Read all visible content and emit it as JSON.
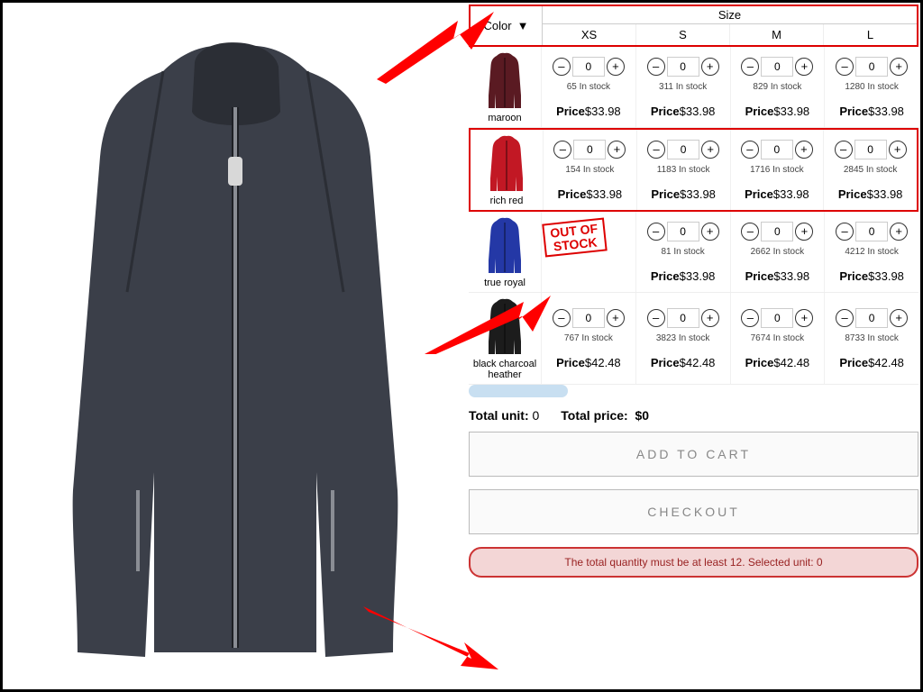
{
  "header": {
    "color_label": "Color",
    "size_label": "Size",
    "sizes": [
      "XS",
      "S",
      "M",
      "L"
    ]
  },
  "rows": [
    {
      "name": "maroon",
      "swatch": "#5a1a22",
      "cells": [
        {
          "qty": "0",
          "stock": "65 In stock",
          "price": "$33.98"
        },
        {
          "qty": "0",
          "stock": "311 In stock",
          "price": "$33.98"
        },
        {
          "qty": "0",
          "stock": "829 In stock",
          "price": "$33.98"
        },
        {
          "qty": "0",
          "stock": "1280 In stock",
          "price": "$33.98"
        }
      ]
    },
    {
      "name": "rich red",
      "swatch": "#c21824",
      "highlight": true,
      "cells": [
        {
          "qty": "0",
          "stock": "154 In stock",
          "price": "$33.98"
        },
        {
          "qty": "0",
          "stock": "1183 In stock",
          "price": "$33.98"
        },
        {
          "qty": "0",
          "stock": "1716 In stock",
          "price": "$33.98"
        },
        {
          "qty": "0",
          "stock": "2845 In stock",
          "price": "$33.98"
        }
      ]
    },
    {
      "name": "true royal",
      "swatch": "#2438a6",
      "cells": [
        {
          "out_of_stock": true
        },
        {
          "qty": "0",
          "stock": "81 In stock",
          "price": "$33.98"
        },
        {
          "qty": "0",
          "stock": "2662 In stock",
          "price": "$33.98"
        },
        {
          "qty": "0",
          "stock": "4212 In stock",
          "price": "$33.98"
        }
      ]
    },
    {
      "name": "black charcoal heather",
      "swatch": "#1c1c1c",
      "cells": [
        {
          "qty": "0",
          "stock": "767 In stock",
          "price": "$42.48"
        },
        {
          "qty": "0",
          "stock": "3823 In stock",
          "price": "$42.48"
        },
        {
          "qty": "0",
          "stock": "7674 In stock",
          "price": "$42.48"
        },
        {
          "qty": "0",
          "stock": "8733 In stock",
          "price": "$42.48"
        }
      ]
    }
  ],
  "out_of_stock_label": "OUT OF\nSTOCK",
  "price_prefix": "Price",
  "totals": {
    "unit_label": "Total unit:",
    "unit_value": "0",
    "price_label": "Total price:",
    "price_value": "$0"
  },
  "buttons": {
    "add": "ADD TO CART",
    "checkout": "CHECKOUT"
  },
  "error": "The total quantity must be at least 12. Selected unit: 0"
}
